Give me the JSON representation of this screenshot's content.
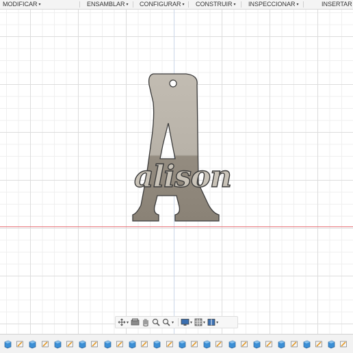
{
  "menubar": {
    "items": [
      {
        "label": "MODIFICAR",
        "name": "menu-modificar"
      },
      {
        "label": "ENSAMBLAR",
        "name": "menu-ensamblar"
      },
      {
        "label": "CONFIGURAR",
        "name": "menu-configurar"
      },
      {
        "label": "CONSTRUIR",
        "name": "menu-construir"
      },
      {
        "label": "INSPECCIONAR",
        "name": "menu-inspeccionar"
      },
      {
        "label": "INSERTAR",
        "name": "menu-insertar"
      }
    ],
    "arrow": "▾"
  },
  "model": {
    "text": "alison",
    "body_color": "#bcb6ac",
    "body_dark_color": "#8f877b",
    "outline_color": "#3a3a3a"
  },
  "navbar": {
    "buttons": [
      "orbit-icon",
      "look-at-icon",
      "pan-icon",
      "zoom-icon",
      "zoom-window-icon",
      "display-mode-icon",
      "grid-icon",
      "viewports-icon"
    ]
  },
  "timeline": {
    "pattern": [
      "body",
      "sketch",
      "body",
      "sketch",
      "body",
      "sketch",
      "body",
      "sketch",
      "body",
      "sketch",
      "body",
      "sketch",
      "body",
      "sketch",
      "body",
      "sketch",
      "body",
      "sketch",
      "body",
      "sketch",
      "body",
      "sketch",
      "body",
      "sketch",
      "body",
      "sketch",
      "body",
      "sketch"
    ],
    "colors": {
      "body": "#3b8fd6",
      "sketch": "#e39b2b"
    }
  },
  "colors": {
    "menu_bg": "#f4f4f4",
    "axis_red": "#e8747a",
    "grid": "#dcdcdc"
  }
}
